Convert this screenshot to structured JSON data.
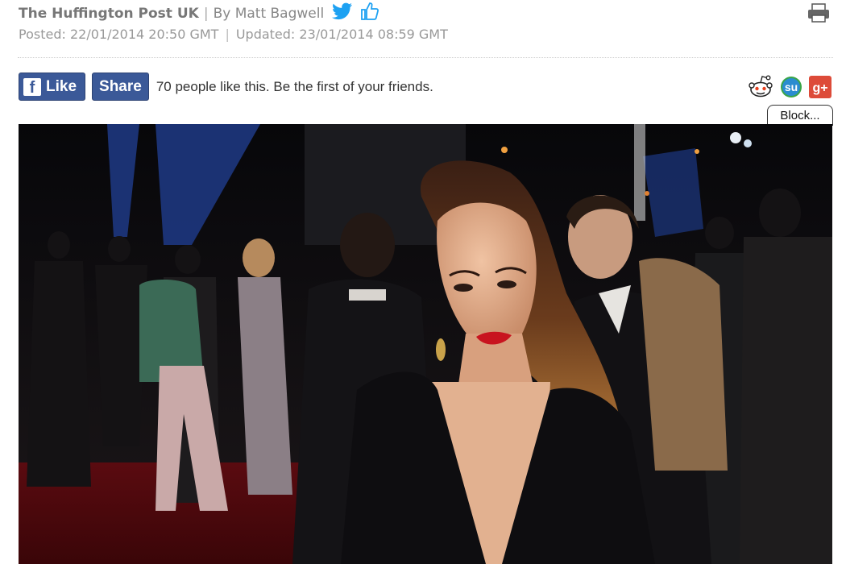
{
  "byline": {
    "publication": "The Huffington Post UK",
    "separator": "|",
    "author": "By Matt Bagwell"
  },
  "dates": {
    "posted": "Posted: 22/01/2014 20:50 GMT",
    "separator": "|",
    "updated": "Updated: 23/01/2014 08:59 GMT"
  },
  "social": {
    "like_label": "Like",
    "share_label": "Share",
    "like_count_text": "70 people like this. Be the first of your friends."
  },
  "share_icons": [
    "reddit-icon",
    "stumbleupon-icon",
    "google-plus-icon"
  ],
  "block_label": "Block...",
  "colors": {
    "facebook_blue": "#3b5998",
    "twitter_blue": "#1da1f2",
    "google_red": "#dd4b39",
    "stumble_green": "#3aa548",
    "lipstick_red": "#c8141f"
  }
}
